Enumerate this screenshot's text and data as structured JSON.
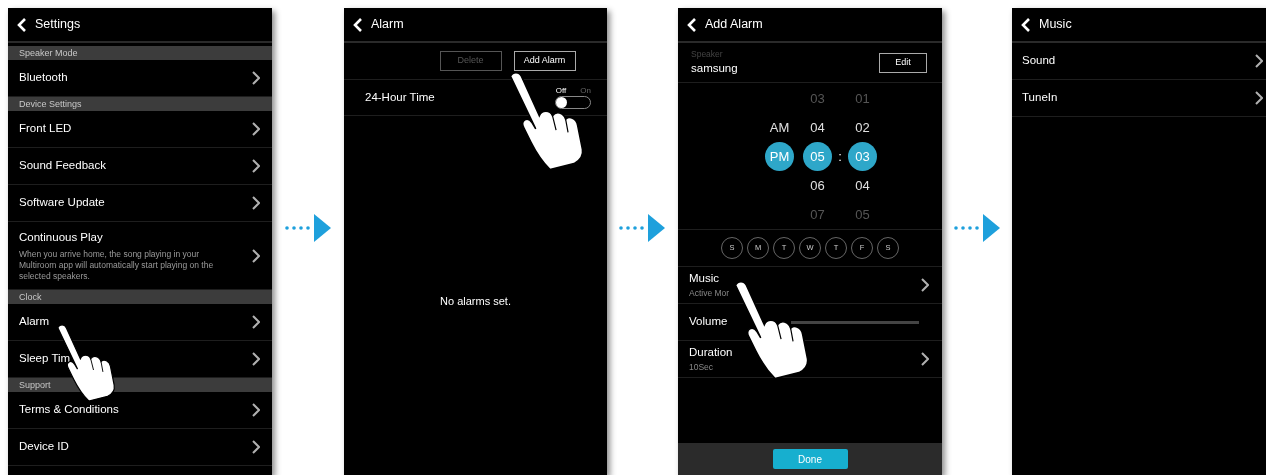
{
  "settings_screen": {
    "title": "Settings",
    "sections": [
      {
        "header": "Speaker Mode",
        "items": [
          {
            "label": "Bluetooth"
          }
        ]
      },
      {
        "header": "Device Settings",
        "items": [
          {
            "label": "Front LED"
          },
          {
            "label": "Sound Feedback"
          },
          {
            "label": "Software Update"
          },
          {
            "label": "Continuous Play",
            "description": "When you arrive home, the song playing in your Multiroom app will automatically start playing on the selected speakers."
          }
        ]
      },
      {
        "header": "Clock",
        "items": [
          {
            "label": "Alarm"
          },
          {
            "label": "Sleep Tim"
          }
        ]
      },
      {
        "header": "Support",
        "items": [
          {
            "label": "Terms & Conditions"
          },
          {
            "label": "Device ID"
          }
        ]
      }
    ]
  },
  "alarm_screen": {
    "title": "Alarm",
    "buttons": [
      {
        "label": "Delete",
        "disabled": true
      },
      {
        "label": "Add Alarm",
        "disabled": false
      }
    ],
    "settings": [
      {
        "label": "24-Hour Time",
        "toggle": {
          "off_label": "Off",
          "on_label": "On",
          "on": false
        }
      }
    ],
    "empty_message": "No alarms set."
  },
  "add_alarm_screen": {
    "title": "Add Alarm",
    "speaker": {
      "label": "Speaker",
      "value": "samsung",
      "button": "Edit"
    },
    "time_picker": {
      "meridiem": [
        {
          "label": "AM",
          "selected": false
        },
        {
          "label": "PM",
          "selected": true
        }
      ],
      "hours": [
        {
          "label": "03",
          "selected": false
        },
        {
          "label": "04",
          "selected": false
        },
        {
          "label": "05",
          "selected": true
        },
        {
          "label": "06",
          "selected": false
        },
        {
          "label": "07",
          "selected": false
        }
      ],
      "separator": ":",
      "minutes": [
        {
          "label": "01",
          "selected": false
        },
        {
          "label": "02",
          "selected": false
        },
        {
          "label": "03",
          "selected": true
        },
        {
          "label": "04",
          "selected": false
        },
        {
          "label": "05",
          "selected": false
        }
      ]
    },
    "days": [
      {
        "label": "S",
        "selected": false
      },
      {
        "label": "M",
        "selected": false
      },
      {
        "label": "T",
        "selected": false
      },
      {
        "label": "W",
        "selected": false
      },
      {
        "label": "T",
        "selected": false
      },
      {
        "label": "F",
        "selected": false
      },
      {
        "label": "S",
        "selected": false
      }
    ],
    "rows": [
      {
        "kind": "link",
        "label": "Music",
        "value": "Active Mor"
      },
      {
        "kind": "slider",
        "label": "Volume"
      },
      {
        "kind": "link",
        "label": "Duration",
        "value": "10Sec"
      }
    ],
    "done_button": "Done"
  },
  "music_screen": {
    "title": "Music",
    "items": [
      {
        "label": "Sound"
      },
      {
        "label": "TuneIn"
      }
    ]
  }
}
